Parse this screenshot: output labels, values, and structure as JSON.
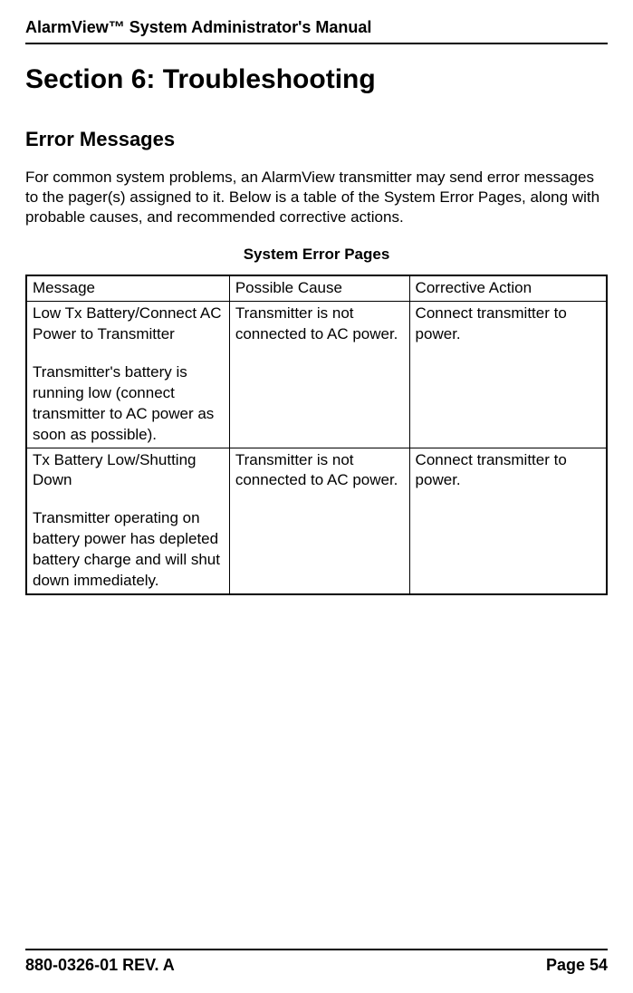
{
  "header": {
    "manual_title": "AlarmView™ System Administrator's Manual"
  },
  "section": {
    "title": "Section 6: Troubleshooting",
    "subtitle": "Error Messages",
    "intro": "For common system problems, an AlarmView transmitter may send error messages to the pager(s) assigned to it. Below is a table of the System Error Pages, along with probable causes, and recommended corrective actions.",
    "table_caption": "System Error Pages"
  },
  "table": {
    "headers": {
      "message": "Message",
      "cause": "Possible Cause",
      "action": "Corrective Action"
    },
    "rows": [
      {
        "message_primary": "Low Tx Battery/Connect AC Power to Transmitter",
        "message_secondary": "Transmitter's battery is running low (connect transmitter to AC power as soon as possible).",
        "cause": "Transmitter is not connected to AC power.",
        "action": "Connect transmitter to power."
      },
      {
        "message_primary": "Tx Battery Low/Shutting Down",
        "message_secondary": "Transmitter operating on battery power has depleted battery charge and will shut down immediately.",
        "cause": "Transmitter is not connected to AC power.",
        "action": "Connect transmitter to power."
      }
    ]
  },
  "footer": {
    "doc_rev": "880-0326-01 REV. A",
    "page_label": "Page 54"
  }
}
